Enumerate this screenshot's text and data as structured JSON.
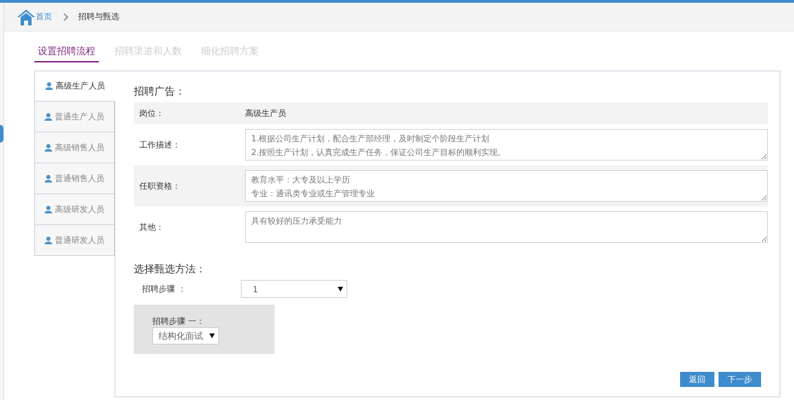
{
  "breadcrumb": {
    "home": "首页",
    "current": "招聘与甄选"
  },
  "tabs": [
    {
      "label": "设置招聘流程",
      "selected": true
    },
    {
      "label": "招聘渠道和人数",
      "selected": false
    },
    {
      "label": "细化招聘方案",
      "selected": false
    }
  ],
  "sidebar": {
    "items": [
      {
        "label": "高级生产人员",
        "selected": true
      },
      {
        "label": "普通生产人员",
        "selected": false
      },
      {
        "label": "高级销售人员",
        "selected": false
      },
      {
        "label": "普通销售人员",
        "selected": false
      },
      {
        "label": "高级研发人员",
        "selected": false
      },
      {
        "label": "普通研发人员",
        "selected": false
      }
    ]
  },
  "advert": {
    "title": "招聘广告：",
    "rows": [
      {
        "kind": "text",
        "label": "岗位：",
        "value": "高级生产员"
      },
      {
        "kind": "textarea",
        "label": "工作描述：",
        "lines": [
          "1.根据公司生产计划，配合生产部经理，及时制定个阶段生产计划",
          "2.按照生产计划，认真完成生产任务，保证公司生产目标的顺利实现。"
        ]
      },
      {
        "kind": "textarea",
        "label": "任职资格：",
        "lines": [
          "教育水平：大专及以上学历",
          "专业：通讯类专业或生产管理专业"
        ]
      },
      {
        "kind": "textarea",
        "label": "其他：",
        "lines": [
          "具有较好的压力承受能力"
        ]
      }
    ]
  },
  "selection": {
    "title": "选择甄选方法：",
    "steps_label": "招聘步骤 ：",
    "steps_value": "1",
    "step_boxes": [
      {
        "label": "招聘步骤 一：",
        "value": "结构化面试"
      }
    ]
  },
  "buttons": [
    "返回",
    "下一步"
  ]
}
